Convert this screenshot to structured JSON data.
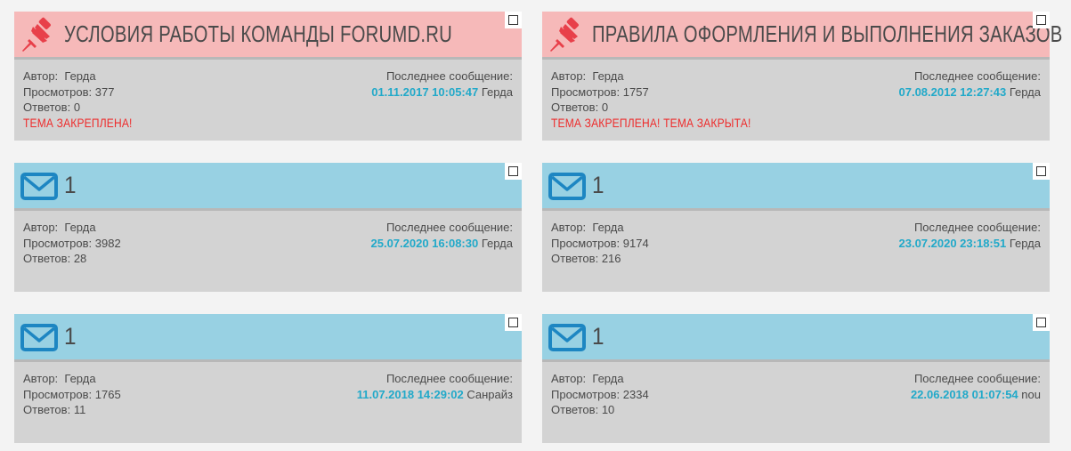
{
  "labels": {
    "author": "Автор:",
    "views": "Просмотров:",
    "replies": "Ответов:",
    "last_message": "Последнее сообщение:"
  },
  "colors": {
    "pinned_header": "#f6b9b9",
    "normal_header": "#98d1e3",
    "card_body": "#d3d3d3",
    "date": "#21a9c9",
    "status": "#ee2b2b",
    "pin_icon": "#e8404a",
    "mail_icon": "#1d86c2"
  },
  "topics": [
    {
      "icon": "pin-icon",
      "title": "УСЛОВИЯ РАБОТЫ КОМАНДЫ FORUMD.RU",
      "author": "Герда",
      "views": "377",
      "replies": "0",
      "last_date": "01.11.2017 10:05:47",
      "last_author": "Герда",
      "status": "ТЕМА ЗАКРЕПЛЕНА!"
    },
    {
      "icon": "pin-icon",
      "title": "ПРАВИЛА ОФОРМЛЕНИЯ И ВЫПОЛНЕНИЯ ЗАКАЗОВ",
      "author": "Герда",
      "views": "1757",
      "replies": "0",
      "last_date": "07.08.2012 12:27:43",
      "last_author": "Герда",
      "status": "ТЕМА ЗАКРЕПЛЕНА! ТЕМА ЗАКРЫТА!"
    },
    {
      "icon": "mail-icon",
      "title": "1",
      "author": "Герда",
      "views": "3982",
      "replies": "28",
      "last_date": "25.07.2020 16:08:30",
      "last_author": "Герда",
      "status": ""
    },
    {
      "icon": "mail-icon",
      "title": "1",
      "author": "Герда",
      "views": "9174",
      "replies": "216",
      "last_date": "23.07.2020 23:18:51",
      "last_author": "Герда",
      "status": ""
    },
    {
      "icon": "mail-icon",
      "title": "1",
      "author": "Герда",
      "views": "1765",
      "replies": "11",
      "last_date": "11.07.2018 14:29:02",
      "last_author": "Санрайз",
      "status": ""
    },
    {
      "icon": "mail-icon",
      "title": "1",
      "author": "Герда",
      "views": "2334",
      "replies": "10",
      "last_date": "22.06.2018 01:07:54",
      "last_author": "nou",
      "status": ""
    }
  ]
}
